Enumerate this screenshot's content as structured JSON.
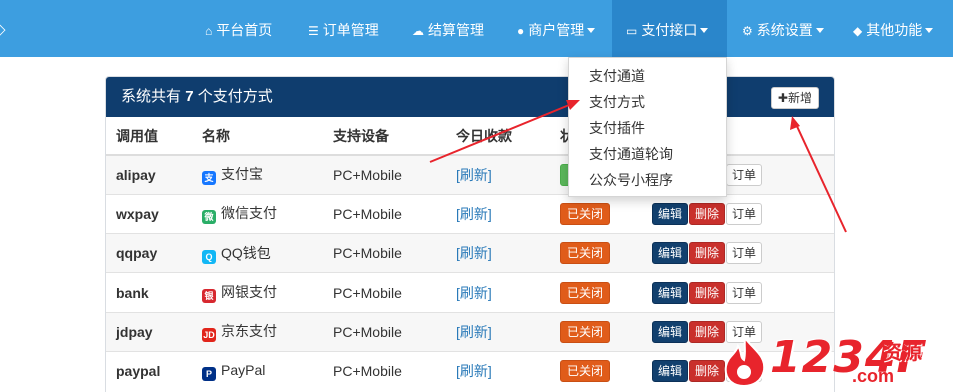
{
  "nav": {
    "items": [
      {
        "icon": "home-icon",
        "label": "平台首页",
        "caret": false
      },
      {
        "icon": "list-icon",
        "label": "订单管理",
        "caret": false
      },
      {
        "icon": "cloud-icon",
        "label": "结算管理",
        "caret": false
      },
      {
        "icon": "user-icon",
        "label": "商户管理",
        "caret": true
      },
      {
        "icon": "card-icon",
        "label": "支付接口",
        "caret": true,
        "active": true
      },
      {
        "icon": "gear-icon",
        "label": "系统设置",
        "caret": true
      },
      {
        "icon": "cube-icon",
        "label": "其他功能",
        "caret": true
      }
    ]
  },
  "dropdown": {
    "items": [
      "支付通道",
      "支付方式",
      "支付插件",
      "支付通道轮询",
      "公众号小程序"
    ]
  },
  "panel": {
    "title_prefix": "系统共有",
    "count": "7",
    "title_suffix": "个支付方式",
    "add_label": "新增"
  },
  "table": {
    "headers": [
      "调用值",
      "名称",
      "支持设备",
      "今日收款",
      "状态",
      "操作"
    ],
    "rows": [
      {
        "value": "alipay",
        "name": "支付宝",
        "icon_color": "#1677ff",
        "icon_text": "支",
        "device": "PC+Mobile",
        "income": "[刷新]",
        "status": "已开启",
        "status_on": true
      },
      {
        "value": "wxpay",
        "name": "微信支付",
        "icon_color": "#2aae67",
        "icon_text": "微",
        "device": "PC+Mobile",
        "income": "[刷新]",
        "status": "已关闭",
        "status_on": false
      },
      {
        "value": "qqpay",
        "name": "QQ钱包",
        "icon_color": "#12b7f5",
        "icon_text": "Q",
        "device": "PC+Mobile",
        "income": "[刷新]",
        "status": "已关闭",
        "status_on": false
      },
      {
        "value": "bank",
        "name": "网银支付",
        "icon_color": "#d7282f",
        "icon_text": "银",
        "device": "PC+Mobile",
        "income": "[刷新]",
        "status": "已关闭",
        "status_on": false
      },
      {
        "value": "jdpay",
        "name": "京东支付",
        "icon_color": "#e1251b",
        "icon_text": "JD",
        "device": "PC+Mobile",
        "income": "[刷新]",
        "status": "已关闭",
        "status_on": false
      },
      {
        "value": "paypal",
        "name": "PayPal",
        "icon_color": "#003087",
        "icon_text": "P",
        "device": "PC+Mobile",
        "income": "[刷新]",
        "status": "已关闭",
        "status_on": false
      }
    ],
    "edit_label": "编辑",
    "delete_label": "删除",
    "order_label": "订单"
  },
  "watermark": {
    "main": "1234F",
    "sub": "资源",
    "domain": ".com"
  },
  "colors": {
    "navbar": "#3d9ee0",
    "panel_header": "#0f3d6e",
    "status_off": "#e05c1a",
    "status_on": "#5cb85c",
    "annotation_arrow": "#e8242c"
  }
}
